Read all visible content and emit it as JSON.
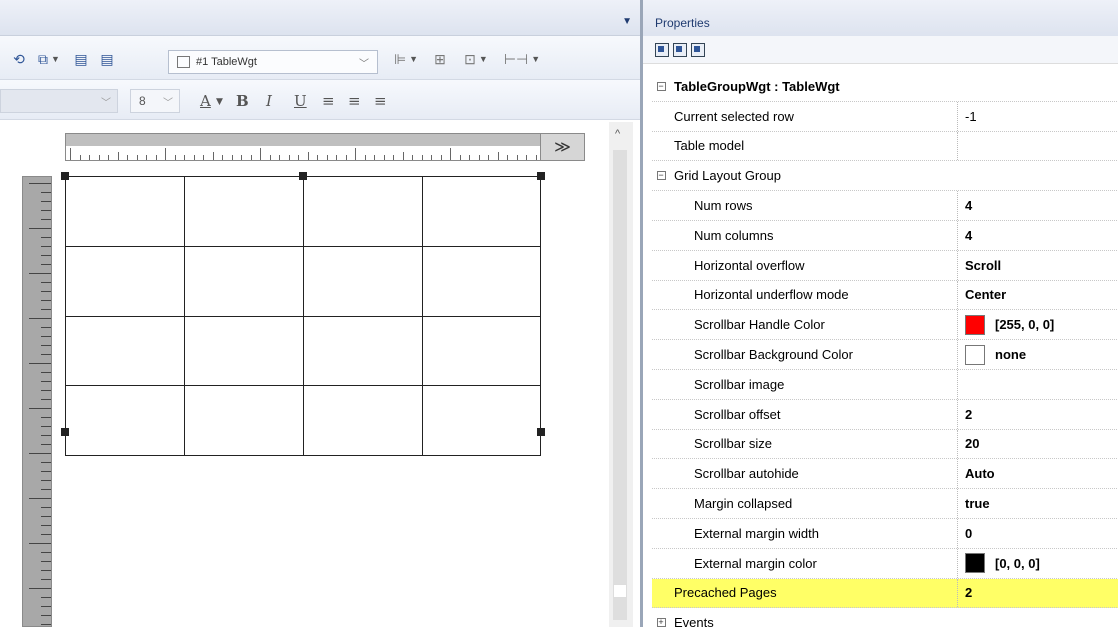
{
  "designer": {
    "widget_selector": "#1 TableWgt",
    "font_size": "8",
    "bold": "B",
    "italic": "I",
    "underline": "U",
    "font_color": "A",
    "ruler_button": "≫"
  },
  "properties": {
    "title": "Properties",
    "group_title": "TableGroupWgt : TableWgt",
    "rows": [
      {
        "name": "Current selected row",
        "value": "-1",
        "bold": false
      },
      {
        "name": "Table model",
        "value": "",
        "bold": false
      },
      {
        "name": "Grid Layout Group",
        "value": "",
        "bold": false,
        "group": true
      },
      {
        "name": "Num rows",
        "value": "4",
        "bold": true
      },
      {
        "name": "Num columns",
        "value": "4",
        "bold": true
      },
      {
        "name": "Horizontal overflow",
        "value": "Scroll",
        "bold": true
      },
      {
        "name": "Horizontal underflow mode",
        "value": "Center",
        "bold": true
      },
      {
        "name": "Scrollbar Handle Color",
        "value": "[255, 0, 0]",
        "bold": true,
        "swatch": "#ff0000"
      },
      {
        "name": "Scrollbar Background Color",
        "value": "none",
        "bold": true,
        "swatch": "#ffffff"
      },
      {
        "name": "Scrollbar image",
        "value": "",
        "bold": true
      },
      {
        "name": "Scrollbar offset",
        "value": "2",
        "bold": true
      },
      {
        "name": "Scrollbar size",
        "value": "20",
        "bold": true
      },
      {
        "name": "Scrollbar autohide",
        "value": "Auto",
        "bold": true
      },
      {
        "name": "Margin collapsed",
        "value": "true",
        "bold": true
      },
      {
        "name": "External margin width",
        "value": "0",
        "bold": true
      },
      {
        "name": "External margin color",
        "value": "[0, 0, 0]",
        "bold": true,
        "swatch": "#000000"
      },
      {
        "name": "Precached Pages",
        "value": "2",
        "bold": true,
        "highlight": true
      },
      {
        "name": "Events",
        "value": "",
        "bold": false,
        "collapsed": true
      }
    ]
  },
  "colors": {
    "highlight": "#ffff66",
    "accent": "#2f5597"
  }
}
